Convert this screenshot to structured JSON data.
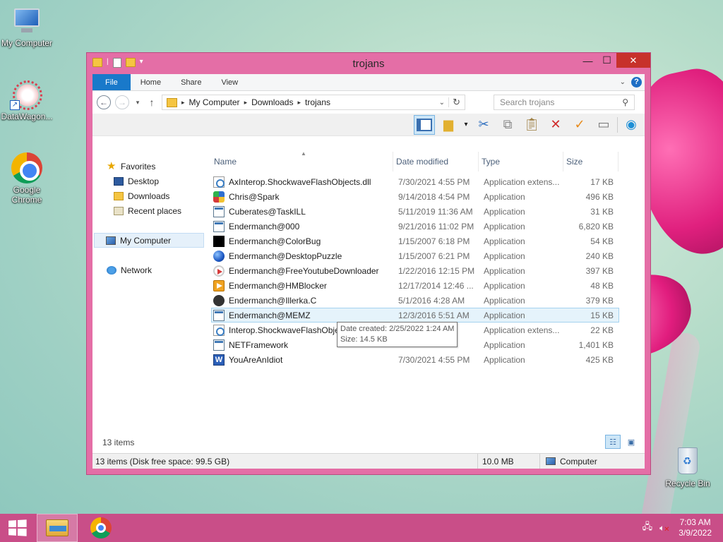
{
  "desktop": {
    "icons": [
      {
        "label": "My Computer",
        "icon": "my-computer-icon"
      },
      {
        "label": "DataWagon...",
        "icon": "datawagon-icon"
      },
      {
        "label": "Google Chrome",
        "icon": "chrome-icon"
      },
      {
        "label": "Recycle Bin",
        "icon": "recycle-bin-icon"
      }
    ]
  },
  "window": {
    "title": "trojans",
    "ribbon_tabs": [
      "File",
      "Home",
      "Share",
      "View"
    ],
    "address": {
      "crumbs": [
        "My Computer",
        "Downloads",
        "trojans"
      ],
      "search_placeholder": "Search trojans"
    },
    "nav": {
      "favorites": "Favorites",
      "favorite_items": [
        "Desktop",
        "Downloads",
        "Recent places"
      ],
      "my_computer": "My Computer",
      "network": "Network"
    },
    "columns": {
      "name": "Name",
      "date": "Date modified",
      "type": "Type",
      "size": "Size"
    },
    "files": [
      {
        "name": "AxInterop.ShockwaveFlashObjects.dll",
        "date": "7/30/2021 4:55 PM",
        "type": "Application extens...",
        "size": "17 KB",
        "icon": "dll-icon"
      },
      {
        "name": "Chris@Spark",
        "date": "9/14/2018 4:54 PM",
        "type": "Application",
        "size": "496 KB",
        "icon": "spark-icon"
      },
      {
        "name": "Cuberates@TaskILL",
        "date": "5/11/2019 11:36 AM",
        "type": "Application",
        "size": "31 KB",
        "icon": "app-icon"
      },
      {
        "name": "Endermanch@000",
        "date": "9/21/2016 11:02 PM",
        "type": "Application",
        "size": "6,820 KB",
        "icon": "app-icon"
      },
      {
        "name": "Endermanch@ColorBug",
        "date": "1/15/2007 6:18 PM",
        "type": "Application",
        "size": "54 KB",
        "icon": "black-square-icon"
      },
      {
        "name": "Endermanch@DesktopPuzzle",
        "date": "1/15/2007 6:21 PM",
        "type": "Application",
        "size": "240 KB",
        "icon": "puzzle-icon"
      },
      {
        "name": "Endermanch@FreeYoutubeDownloader",
        "date": "1/22/2016 12:15 PM",
        "type": "Application",
        "size": "397 KB",
        "icon": "youtube-downloader-icon"
      },
      {
        "name": "Endermanch@HMBlocker",
        "date": "12/17/2014 12:46 ...",
        "type": "Application",
        "size": "48 KB",
        "icon": "play-icon"
      },
      {
        "name": "Endermanch@Illerka.C",
        "date": "5/1/2016 4:28 AM",
        "type": "Application",
        "size": "379 KB",
        "icon": "bomb-icon"
      },
      {
        "name": "Endermanch@MEMZ",
        "date": "12/3/2016 5:51 AM",
        "type": "Application",
        "size": "15 KB",
        "icon": "app-icon",
        "selected": true
      },
      {
        "name": "Interop.ShockwaveFlashObje",
        "date": "",
        "type": "Application extens...",
        "size": "22 KB",
        "icon": "dll-icon"
      },
      {
        "name": "NETFramework",
        "date": "",
        "type": "Application",
        "size": "1,401 KB",
        "icon": "app-icon"
      },
      {
        "name": "YouAreAnIdiot",
        "date": "7/30/2021 4:55 PM",
        "type": "Application",
        "size": "425 KB",
        "icon": "word-icon"
      }
    ],
    "tooltip": {
      "line1": "Date created: 2/25/2022 1:24 AM",
      "line2": "Size: 14.5 KB"
    },
    "items_count": "13 items",
    "status": {
      "info": "13 items (Disk free space: 99.5 GB)",
      "size": "10.0 MB",
      "location": "Computer"
    }
  },
  "taskbar": {
    "time": "7:03 AM",
    "date": "3/9/2022"
  },
  "colors": {
    "window_frame": "#e46ea6",
    "taskbar": "#c94e88",
    "file_tab": "#1979ca",
    "close_button": "#c7312b"
  }
}
